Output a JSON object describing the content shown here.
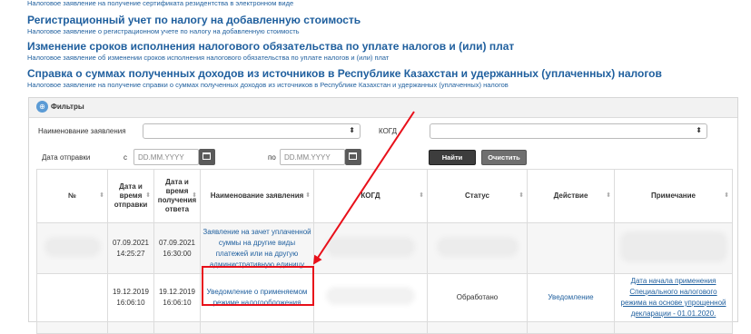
{
  "top_items": [
    {
      "subtitle": "Налоговое заявление на получение сертификата резидентства в электронном виде"
    },
    {
      "title": "Регистрационный учет по налогу на добавленную стоимость",
      "subtitle": "Налоговое заявление о регистрационном учете по налогу на добавленную стоимость"
    },
    {
      "title": "Изменение сроков исполнения налогового обязательства по уплате налогов и (или) плат",
      "subtitle": "Налоговое заявление об изменении сроков исполнения налогового обязательства по уплате налогов и (или) плат"
    },
    {
      "title": "Справка о суммах полученных доходов из источников в Республике Казахстан и удержанных (уплаченных) налогов",
      "subtitle": "Налоговое заявление на получение справки о суммах полученных доходов из источников в Республике Казахстан и удержанных (уплаченных) налогов"
    }
  ],
  "filters": {
    "title": "Фильтры",
    "app_name_label": "Наименование заявления",
    "kogd_label": "КОГД",
    "send_date_label": "Дата отправки",
    "from_label": "с",
    "to_label": "по",
    "date_placeholder": "DD.MM.YYYY",
    "find_button": "Найти",
    "clear_button": "Очистить"
  },
  "table": {
    "headers": [
      "№",
      "Дата и время отправки",
      "Дата и время получения ответа",
      "Наименование заявления",
      "КОГД",
      "Статус",
      "Действие",
      "Примечание"
    ],
    "rows": [
      {
        "sent": "07.09.2021 14:25:27",
        "received": "07.09.2021 16:30:00",
        "name": "Заявление на зачет уплаченной суммы на другие виды платежей или на другую административную единицу",
        "status": "",
        "action": "",
        "note": ""
      },
      {
        "sent": "19.12.2019 16:06:10",
        "received": "19.12.2019 16:06:10",
        "name": "Уведомление о применяемом режиме налогообложения",
        "status": "Обработано",
        "action": "Уведомление",
        "note": "Дата начала применения Специального налогового режима на основе упрощенной декларации - 01.01.2020."
      }
    ]
  },
  "colors": {
    "link": "#1f5f9e",
    "highlight": "#e8101a"
  }
}
